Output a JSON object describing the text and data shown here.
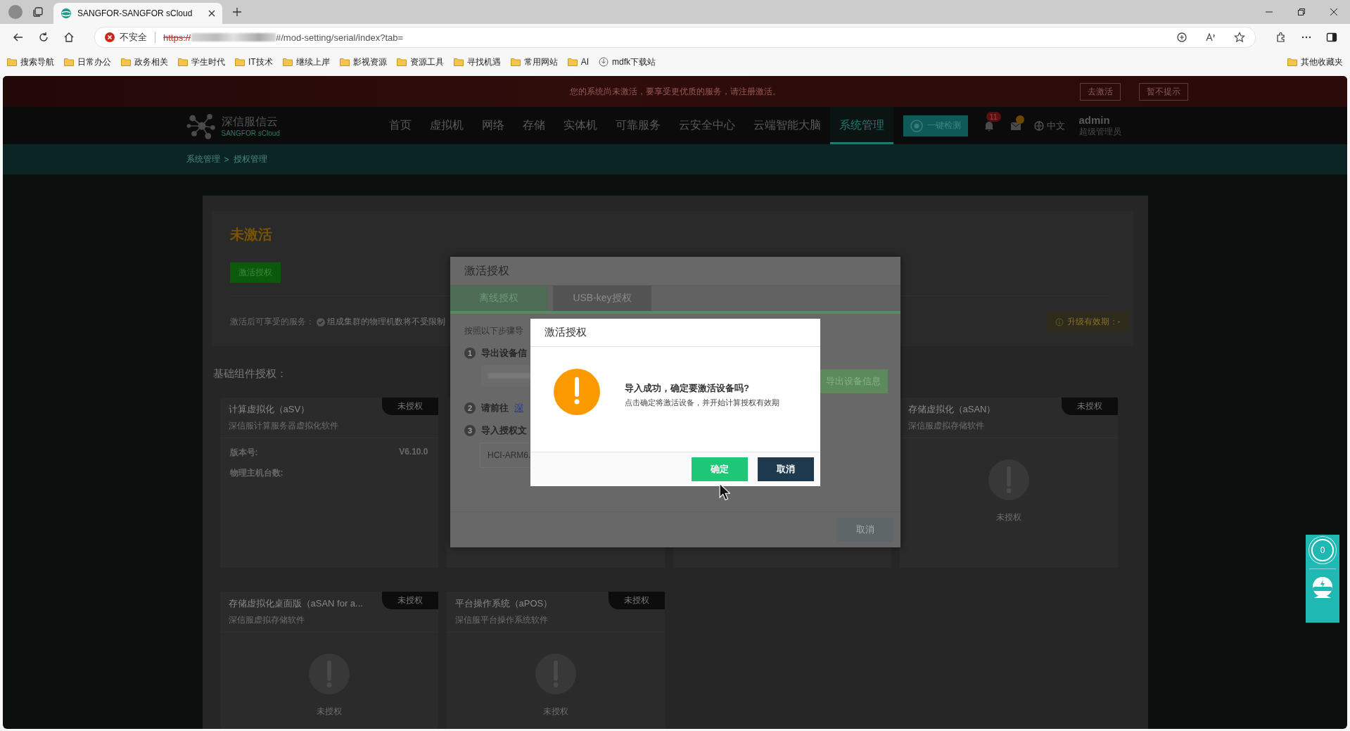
{
  "browser": {
    "tab": {
      "title": "SANGFOR-SANGFOR sCloud",
      "selected": true
    },
    "security_label": "不安全",
    "url": {
      "scheme": "https://",
      "path": "#/mod-setting/serial/index?tab="
    },
    "bookmarks": [
      {
        "label": "搜索导航",
        "kind": "folder"
      },
      {
        "label": "日常办公",
        "kind": "folder"
      },
      {
        "label": "政务相关",
        "kind": "folder"
      },
      {
        "label": "学生时代",
        "kind": "folder"
      },
      {
        "label": "IT技术",
        "kind": "folder"
      },
      {
        "label": "继续上岸",
        "kind": "folder"
      },
      {
        "label": "影视资源",
        "kind": "folder"
      },
      {
        "label": "资源工具",
        "kind": "folder"
      },
      {
        "label": "寻找机遇",
        "kind": "folder"
      },
      {
        "label": "常用网站",
        "kind": "folder"
      },
      {
        "label": "AI",
        "kind": "folder"
      },
      {
        "label": "mdfk下载站",
        "kind": "link"
      }
    ],
    "other_bookmarks": "其他收藏夹"
  },
  "banner": {
    "message": "您的系统尚未激活，要享受更优质的服务，请注册激活。",
    "buttons": [
      "去激活",
      "暂不提示"
    ]
  },
  "header": {
    "logo": {
      "name": "深信服信云",
      "sub": "SANGFOR sCloud"
    },
    "nav": [
      {
        "label": "首页",
        "selected": false
      },
      {
        "label": "虚拟机",
        "selected": false
      },
      {
        "label": "网络",
        "selected": false
      },
      {
        "label": "存储",
        "selected": false
      },
      {
        "label": "实体机",
        "selected": false
      },
      {
        "label": "可靠服务",
        "selected": false
      },
      {
        "label": "云安全中心",
        "selected": false
      },
      {
        "label": "云端智能大脑",
        "selected": false
      },
      {
        "label": "系统管理",
        "selected": true
      }
    ],
    "check_button": "一键检测",
    "notification_count": "11",
    "language": "中文",
    "user": {
      "name": "admin",
      "role": "超级管理员"
    }
  },
  "breadcrumb": {
    "items": [
      "系统管理",
      "授权管理"
    ],
    "separator": ">"
  },
  "license": {
    "status": "未激活",
    "activate_button": "激活授权",
    "services_label": "激活后可享受的服务：",
    "service": "组成集群的物理机数将不受限制",
    "upgrade_validity": "升级有效期：-",
    "section_title": "基础组件授权：",
    "cards": [
      {
        "kind": "detail",
        "title": "计算虚拟化（aSV）",
        "badge": "未授权",
        "description": "深信服计算服务器虚拟化软件",
        "fields": [
          {
            "label": "版本号:",
            "value": "V6.10.0"
          },
          {
            "label": "物理主机台数:"
          }
        ]
      },
      {
        "kind": "covered"
      },
      {
        "kind": "covered"
      },
      {
        "kind": "unlicensed",
        "title": "存储虚拟化（aSAN）",
        "badge": "未授权",
        "description": "深信服虚拟存储软件",
        "status": "未授权"
      },
      {
        "kind": "unlicensed",
        "title": "存储虚拟化桌面版（aSAN for a...",
        "badge": "未授权",
        "description": "深信服虚拟存储软件",
        "status": "未授权"
      },
      {
        "kind": "unlicensed",
        "title": "平台操作系统（aPOS）",
        "badge": "未授权",
        "description": "深信服平台操作系统软件",
        "status": "未授权"
      }
    ]
  },
  "activation_dialog": {
    "title": "激活授权",
    "tabs": [
      {
        "label": "离线授权",
        "selected": true
      },
      {
        "label": "USB-key授权",
        "selected": false
      }
    ],
    "intro": "按照以下步骤导",
    "steps": [
      {
        "number": "1",
        "title": "导出设备信"
      },
      {
        "number": "2",
        "title": "请前往",
        "link": "深"
      },
      {
        "number": "3",
        "title": "导入授权文",
        "file": "HCI-ARM6."
      }
    ],
    "export_button": "导出设备信息",
    "cancel_button": "取消"
  },
  "confirm_dialog": {
    "title": "激活授权",
    "message": "导入成功，确定要激活设备吗?",
    "detail": "点击确定将激活设备，并开始计算授权有效期",
    "buttons": [
      {
        "label": "确定",
        "kind": "primary"
      },
      {
        "label": "取消",
        "kind": "secondary"
      }
    ]
  },
  "assistant_widget": {
    "count": "0"
  }
}
